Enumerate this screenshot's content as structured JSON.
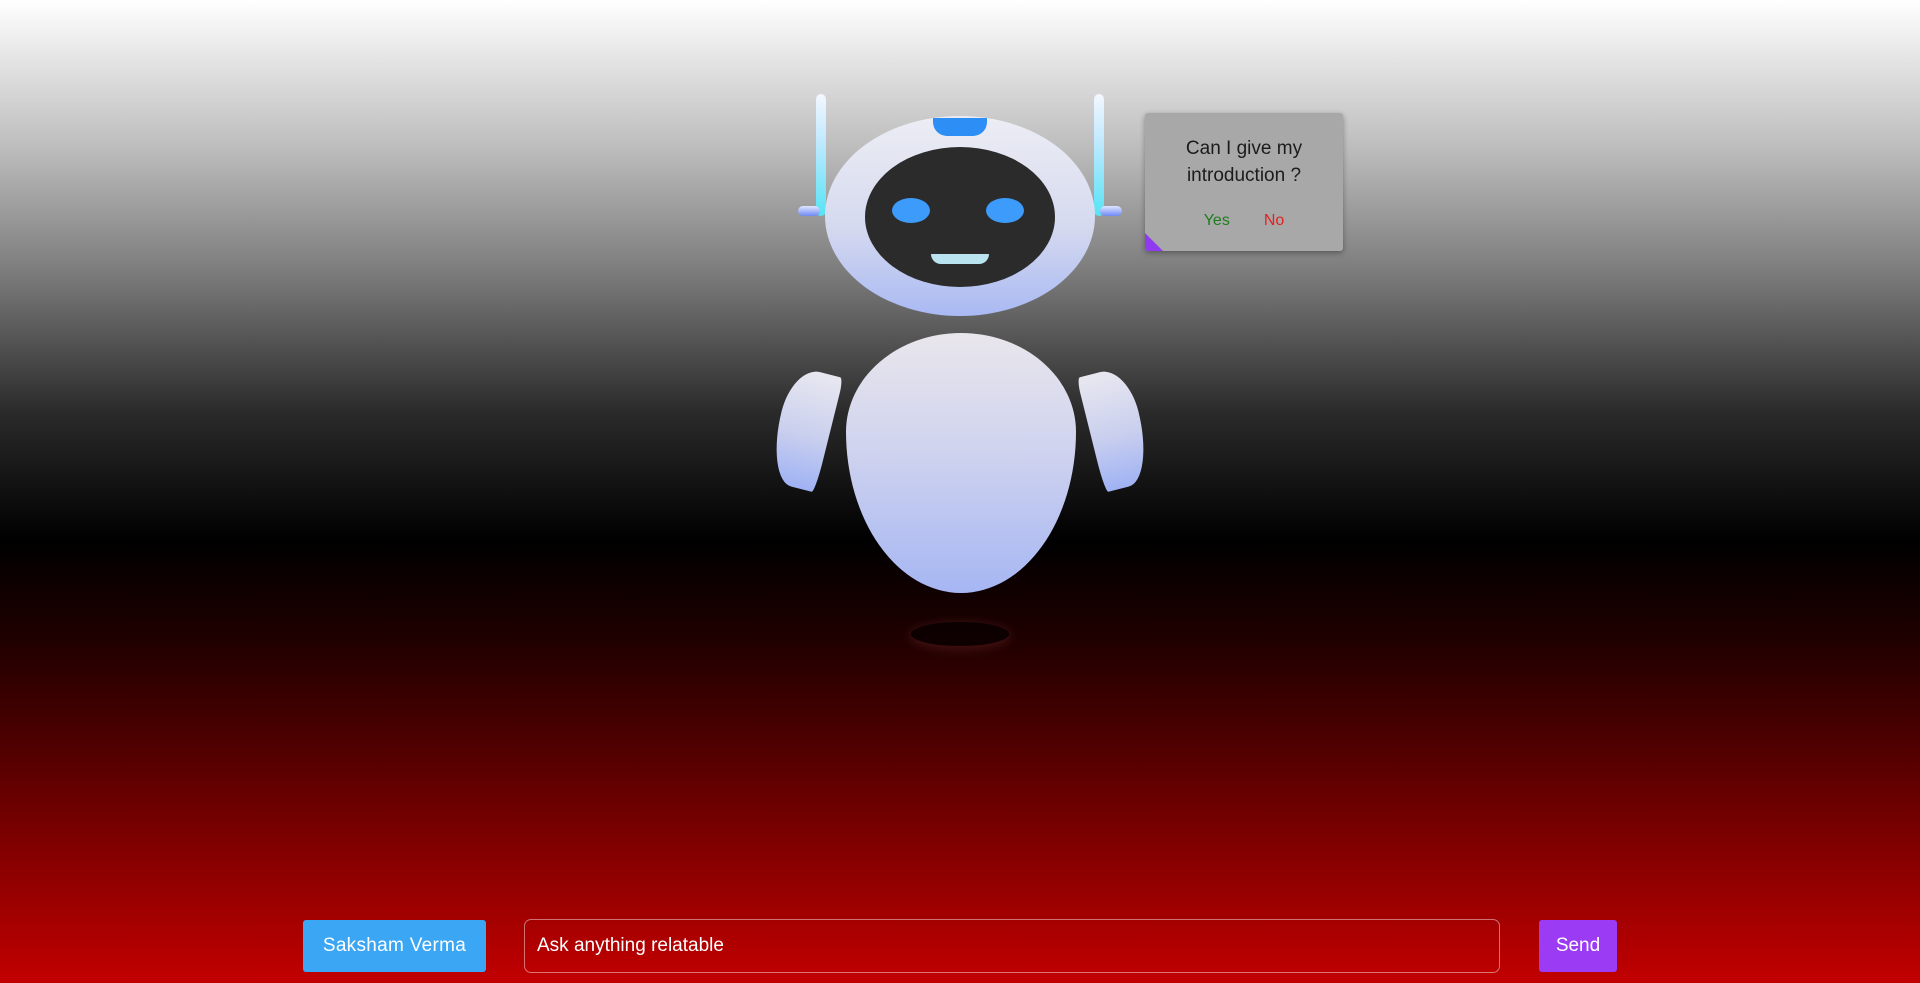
{
  "speech_bubble": {
    "question": "Can I give my introduction ?",
    "yes_label": "Yes",
    "no_label": "No",
    "yes_color": "#1d7d1d",
    "no_color": "#e22222"
  },
  "chat_bar": {
    "user_label": "Saksham Verma",
    "input_placeholder": "Ask anything relatable",
    "input_value": "",
    "send_label": "Send"
  },
  "colors": {
    "user_button": "#3aa6f4",
    "send_button": "#9b3bf3",
    "robot_accent": "#2d8ff5",
    "robot_eyes": "#3c9bfb",
    "antenna_glow": "#57e3f5"
  },
  "icons": {
    "robot": "robot-illustration"
  }
}
